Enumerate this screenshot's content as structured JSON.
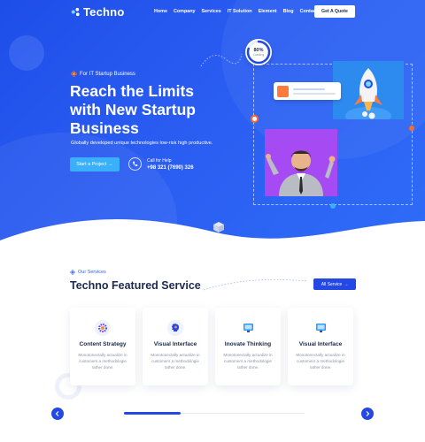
{
  "brand": {
    "name": "Techno"
  },
  "nav": {
    "items": [
      "Home",
      "Company",
      "Services",
      "IT Solution",
      "Element",
      "Blog",
      "Contact"
    ],
    "cta": "Get A Quote"
  },
  "hero": {
    "eyebrow": "For IT Startup Business",
    "title_lines": [
      "Reach the Limits",
      "with New Startup",
      "Business"
    ],
    "description": "Globally developed unique technologies low-risk high productive.",
    "primary_button": "Start a Project",
    "call_label": "Call for Help",
    "call_phone": "+98 321 (7690) 326",
    "progress_value": "80%",
    "progress_sub": "Loading",
    "progress_fraction": 0.8
  },
  "services": {
    "eyebrow": "Our Services",
    "title": "Techno Featured Service",
    "all_button": "All Service",
    "cards": [
      {
        "title": "Content Strategy",
        "icon": "gear-icon",
        "desc_lines": [
          "Monotonectally actualize in",
          "customers a methodologie",
          "rather done."
        ]
      },
      {
        "title": "Visual Interface",
        "icon": "brain-icon",
        "desc_lines": [
          "Monotonectally actualize in",
          "customers a methodologie",
          "rather done."
        ]
      },
      {
        "title": "Inovate Thinking",
        "icon": "monitor-icon",
        "desc_lines": [
          "Monotonectally actualize in",
          "customers a methodologie",
          "rather done."
        ]
      },
      {
        "title": "Visual Interface",
        "icon": "monitor-icon",
        "desc_lines": [
          "Monotonectally actualize in",
          "customers a methodologie",
          "rather done."
        ]
      }
    ]
  },
  "colors": {
    "primary": "#2348e6",
    "accent": "#3ab0fa",
    "orange": "#ff6a2c",
    "purple": "#a64bf4",
    "dark": "#1b2a4e"
  }
}
